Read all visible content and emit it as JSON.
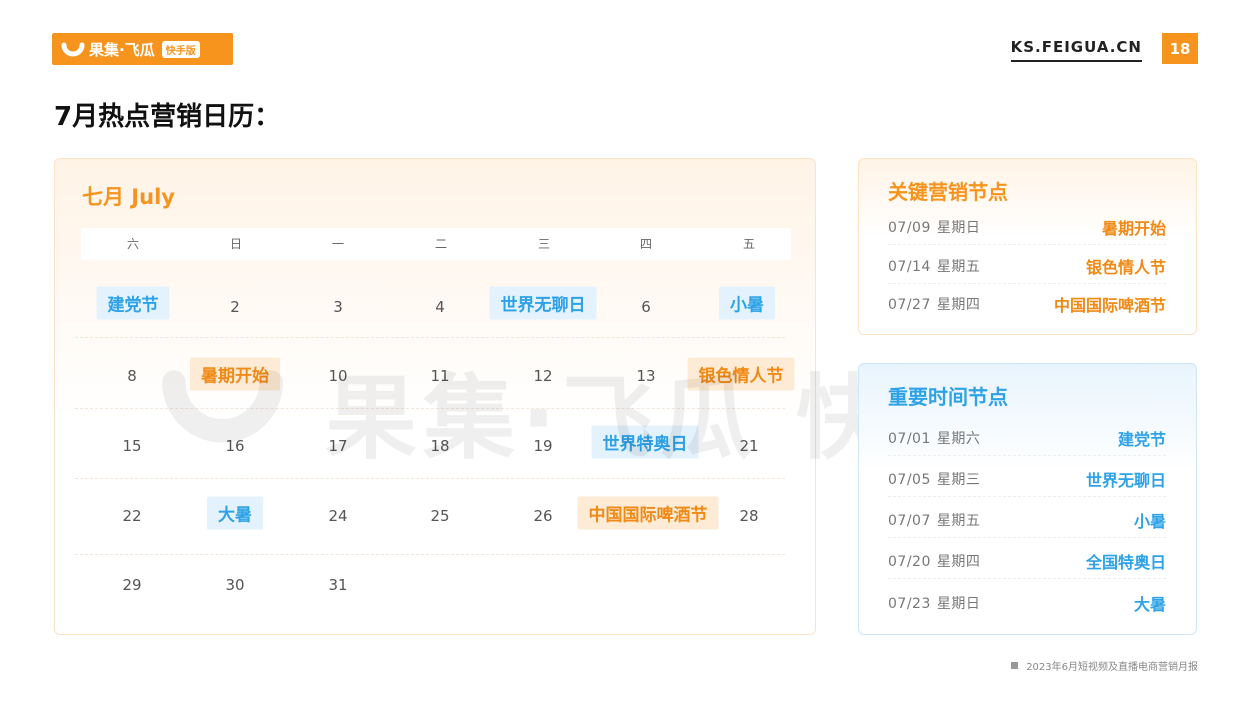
{
  "header": {
    "brand": "果集·飞瓜",
    "brand_badge": "快手版",
    "site": "KS.FEIGUA.CN",
    "page_number": "18"
  },
  "page_title": "7月热点营销日历：",
  "calendar": {
    "title": "七月 July",
    "weekdays": [
      "六",
      "日",
      "一",
      "二",
      "三",
      "四",
      "五"
    ],
    "days": {
      "d2": "2",
      "d3": "3",
      "d4": "4",
      "d6": "6",
      "d8": "8",
      "d10": "10",
      "d11": "11",
      "d12": "12",
      "d13": "13",
      "d15": "15",
      "d16": "16",
      "d17": "17",
      "d18": "18",
      "d19": "19",
      "d21": "21",
      "d22": "22",
      "d24": "24",
      "d25": "25",
      "d26": "26",
      "d28": "28",
      "d29": "29",
      "d30": "30",
      "d31": "31"
    },
    "tags": {
      "jiandang": "建党节",
      "wuliao": "世界无聊日",
      "xiaoshu": "小暑",
      "shuqi": "暑期开始",
      "yinse": "银色情人节",
      "teao": "世界特奥日",
      "dashu": "大暑",
      "pijiu": "中国国际啤酒节"
    }
  },
  "watermark": "果集·飞瓜 快手版",
  "key_marketing": {
    "title": "关键营销节点",
    "rows": [
      {
        "date": "07/09",
        "weekday": "星期日",
        "event": "暑期开始"
      },
      {
        "date": "07/14",
        "weekday": "星期五",
        "event": "银色情人节"
      },
      {
        "date": "07/27",
        "weekday": "星期四",
        "event": "中国国际啤酒节"
      }
    ]
  },
  "important_dates": {
    "title": "重要时间节点",
    "rows": [
      {
        "date": "07/01",
        "weekday": "星期六",
        "event": "建党节"
      },
      {
        "date": "07/05",
        "weekday": "星期三",
        "event": "世界无聊日"
      },
      {
        "date": "07/07",
        "weekday": "星期五",
        "event": "小暑"
      },
      {
        "date": "07/20",
        "weekday": "星期四",
        "event": "全国特奥日"
      },
      {
        "date": "07/23",
        "weekday": "星期日",
        "event": "大暑"
      }
    ]
  },
  "footer": "2023年6月短视频及直播电商营销月报",
  "colors": {
    "brand_orange": "#f7941d",
    "accent_blue": "#2ea2e6"
  }
}
